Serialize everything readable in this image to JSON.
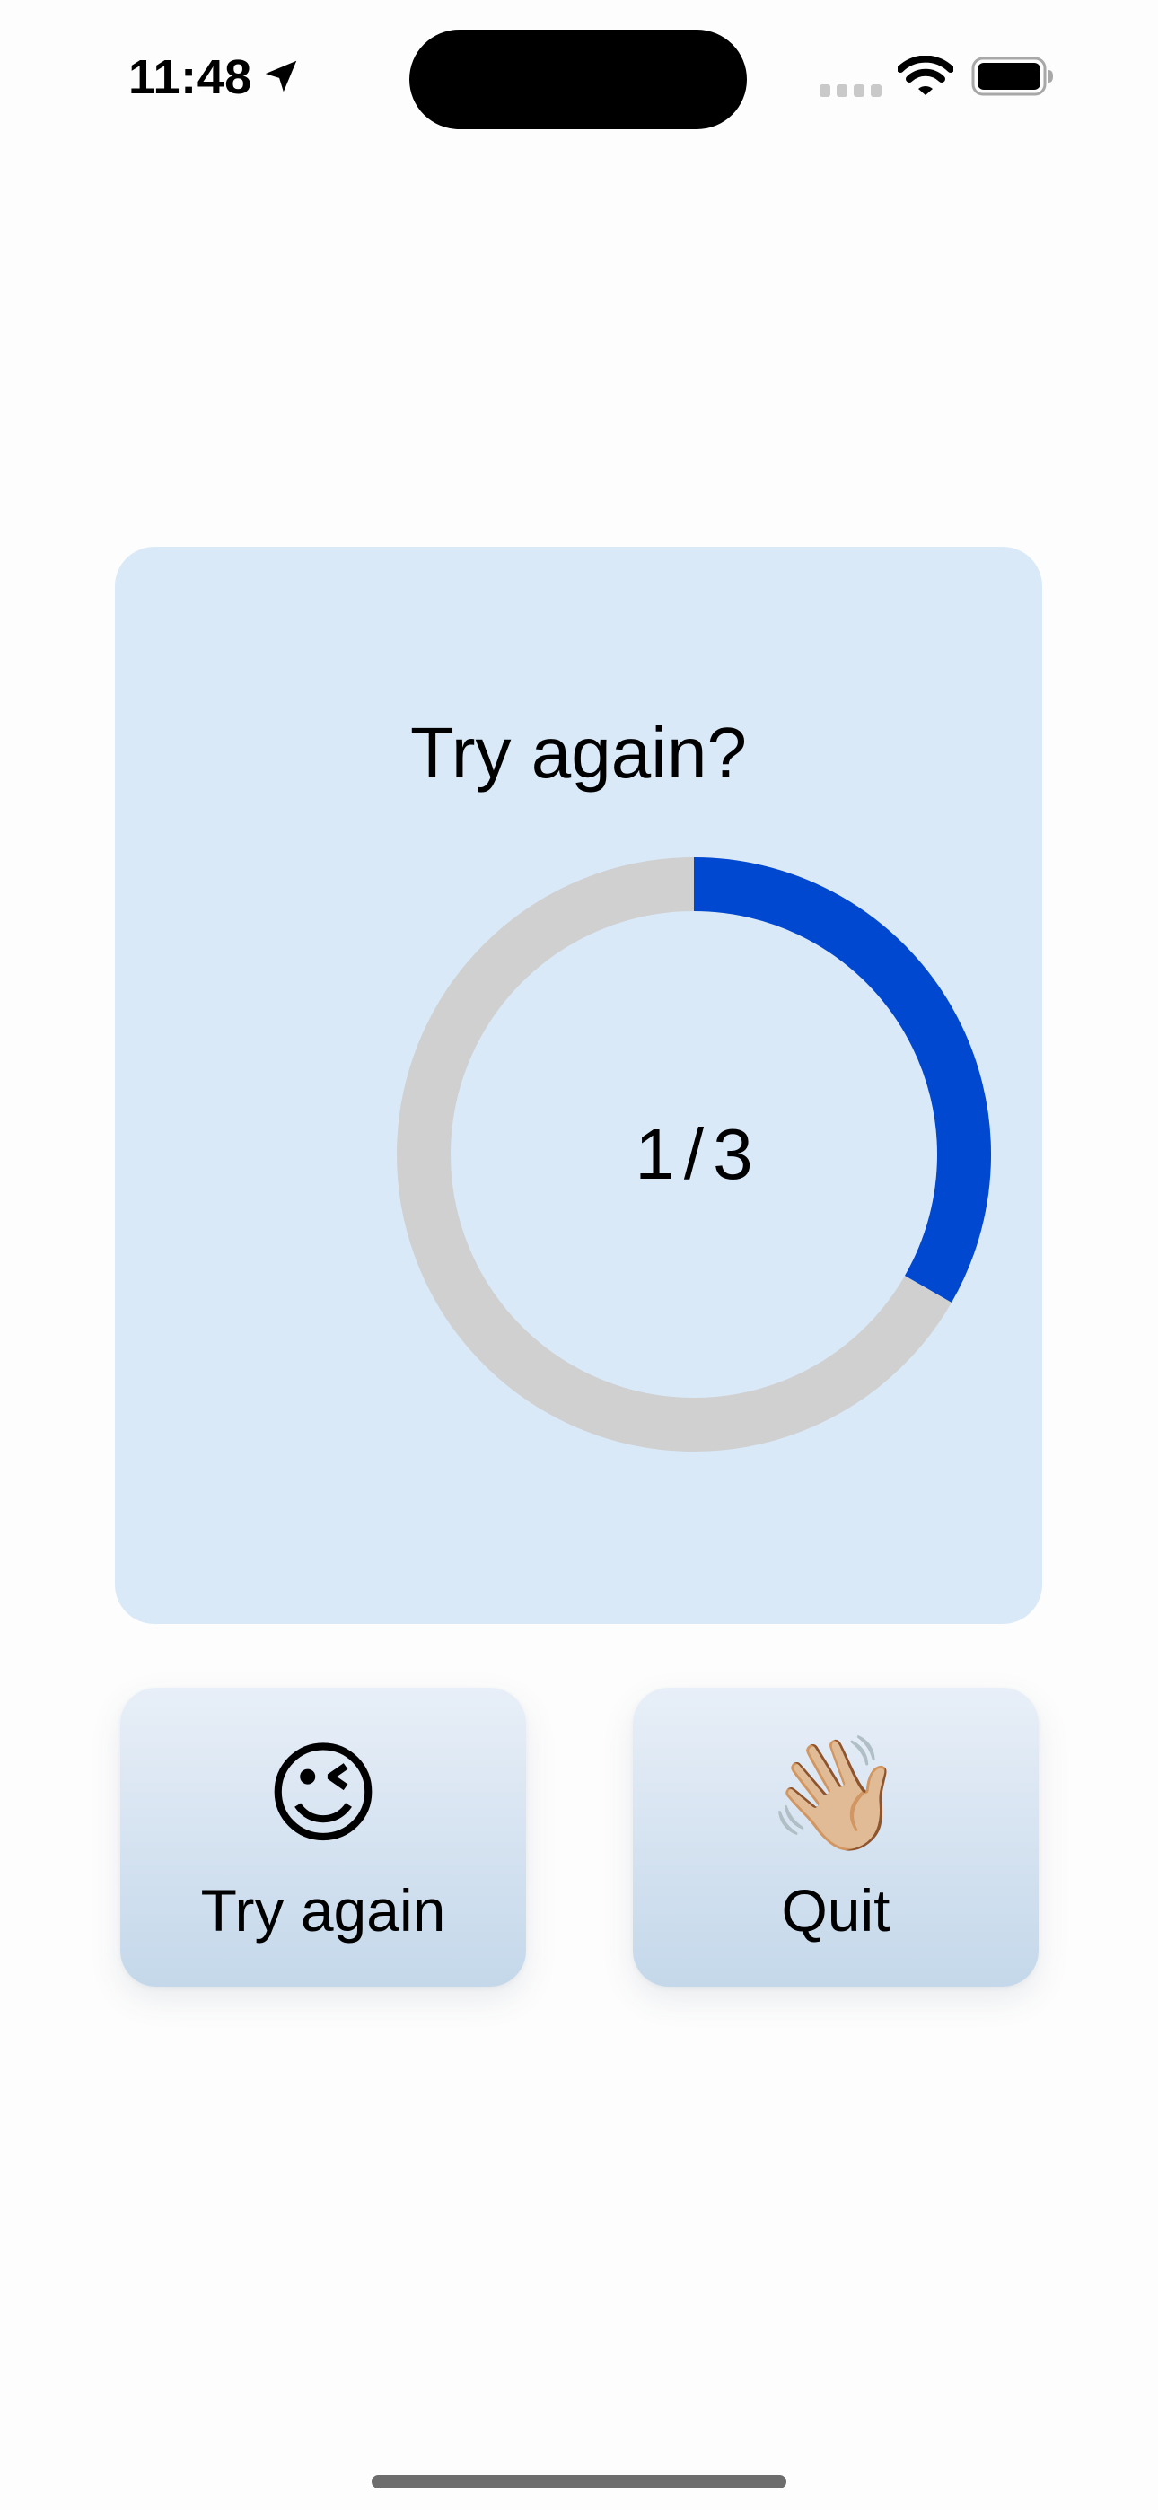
{
  "status_bar": {
    "time": "11:48",
    "icons": [
      "location-arrow-icon",
      "cellular-signal-icon",
      "wifi-icon",
      "battery-icon"
    ]
  },
  "card": {
    "title": "Try again?",
    "progress": {
      "current": "1",
      "separator": "/",
      "total": "3",
      "fraction": 0.333,
      "color": "#0048d0",
      "track_color": "#d0d0d0"
    },
    "background": "#d9e9f8"
  },
  "buttons": {
    "try_again": {
      "emoji": "😉",
      "label": "Try again",
      "icon": "winking-face-icon"
    },
    "quit": {
      "emoji": "👋🏼",
      "label": "Quit",
      "icon": "waving-hand-icon"
    }
  }
}
